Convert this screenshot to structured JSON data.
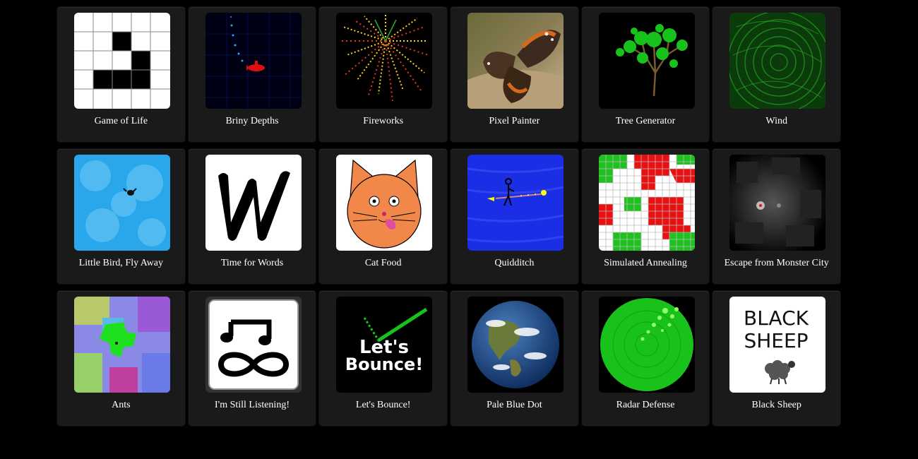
{
  "games": [
    {
      "id": "game-of-life",
      "title": "Game of Life",
      "icon": "game-of-life-icon"
    },
    {
      "id": "briny-depths",
      "title": "Briny Depths",
      "icon": "submarine-icon"
    },
    {
      "id": "fireworks",
      "title": "Fireworks",
      "icon": "fireworks-icon"
    },
    {
      "id": "pixel-painter",
      "title": "Pixel Painter",
      "icon": "butterfly-icon"
    },
    {
      "id": "tree-generator",
      "title": "Tree Generator",
      "icon": "tree-icon"
    },
    {
      "id": "wind",
      "title": "Wind",
      "icon": "wind-swirl-icon"
    },
    {
      "id": "little-bird",
      "title": "Little Bird, Fly Away",
      "icon": "bird-icon"
    },
    {
      "id": "time-for-words",
      "title": "Time for Words",
      "icon": "letter-w-icon"
    },
    {
      "id": "cat-food",
      "title": "Cat Food",
      "icon": "cat-face-icon"
    },
    {
      "id": "quidditch",
      "title": "Quidditch",
      "icon": "broom-rider-icon"
    },
    {
      "id": "simulated-annealing",
      "title": "Simulated Annealing",
      "icon": "annealing-grid-icon"
    },
    {
      "id": "escape-monster-city",
      "title": "Escape from Monster City",
      "icon": "monster-city-icon"
    },
    {
      "id": "ants",
      "title": "Ants",
      "icon": "ants-icon"
    },
    {
      "id": "still-listening",
      "title": "I'm Still Listening!",
      "icon": "music-infinity-icon"
    },
    {
      "id": "lets-bounce",
      "title": "Let's Bounce!",
      "icon": "bounce-logo-icon",
      "thumb_text": [
        "Let's",
        "Bounce!"
      ]
    },
    {
      "id": "pale-blue-dot",
      "title": "Pale Blue Dot",
      "icon": "earth-icon"
    },
    {
      "id": "radar-defense",
      "title": "Radar Defense",
      "icon": "radar-icon"
    },
    {
      "id": "black-sheep",
      "title": "Black Sheep",
      "icon": "sheep-icon",
      "thumb_text": [
        "BLACK",
        "SHEEP"
      ]
    }
  ],
  "colors": {
    "background": "#000000",
    "card": "#1a1a1a",
    "text": "#ffffff"
  }
}
